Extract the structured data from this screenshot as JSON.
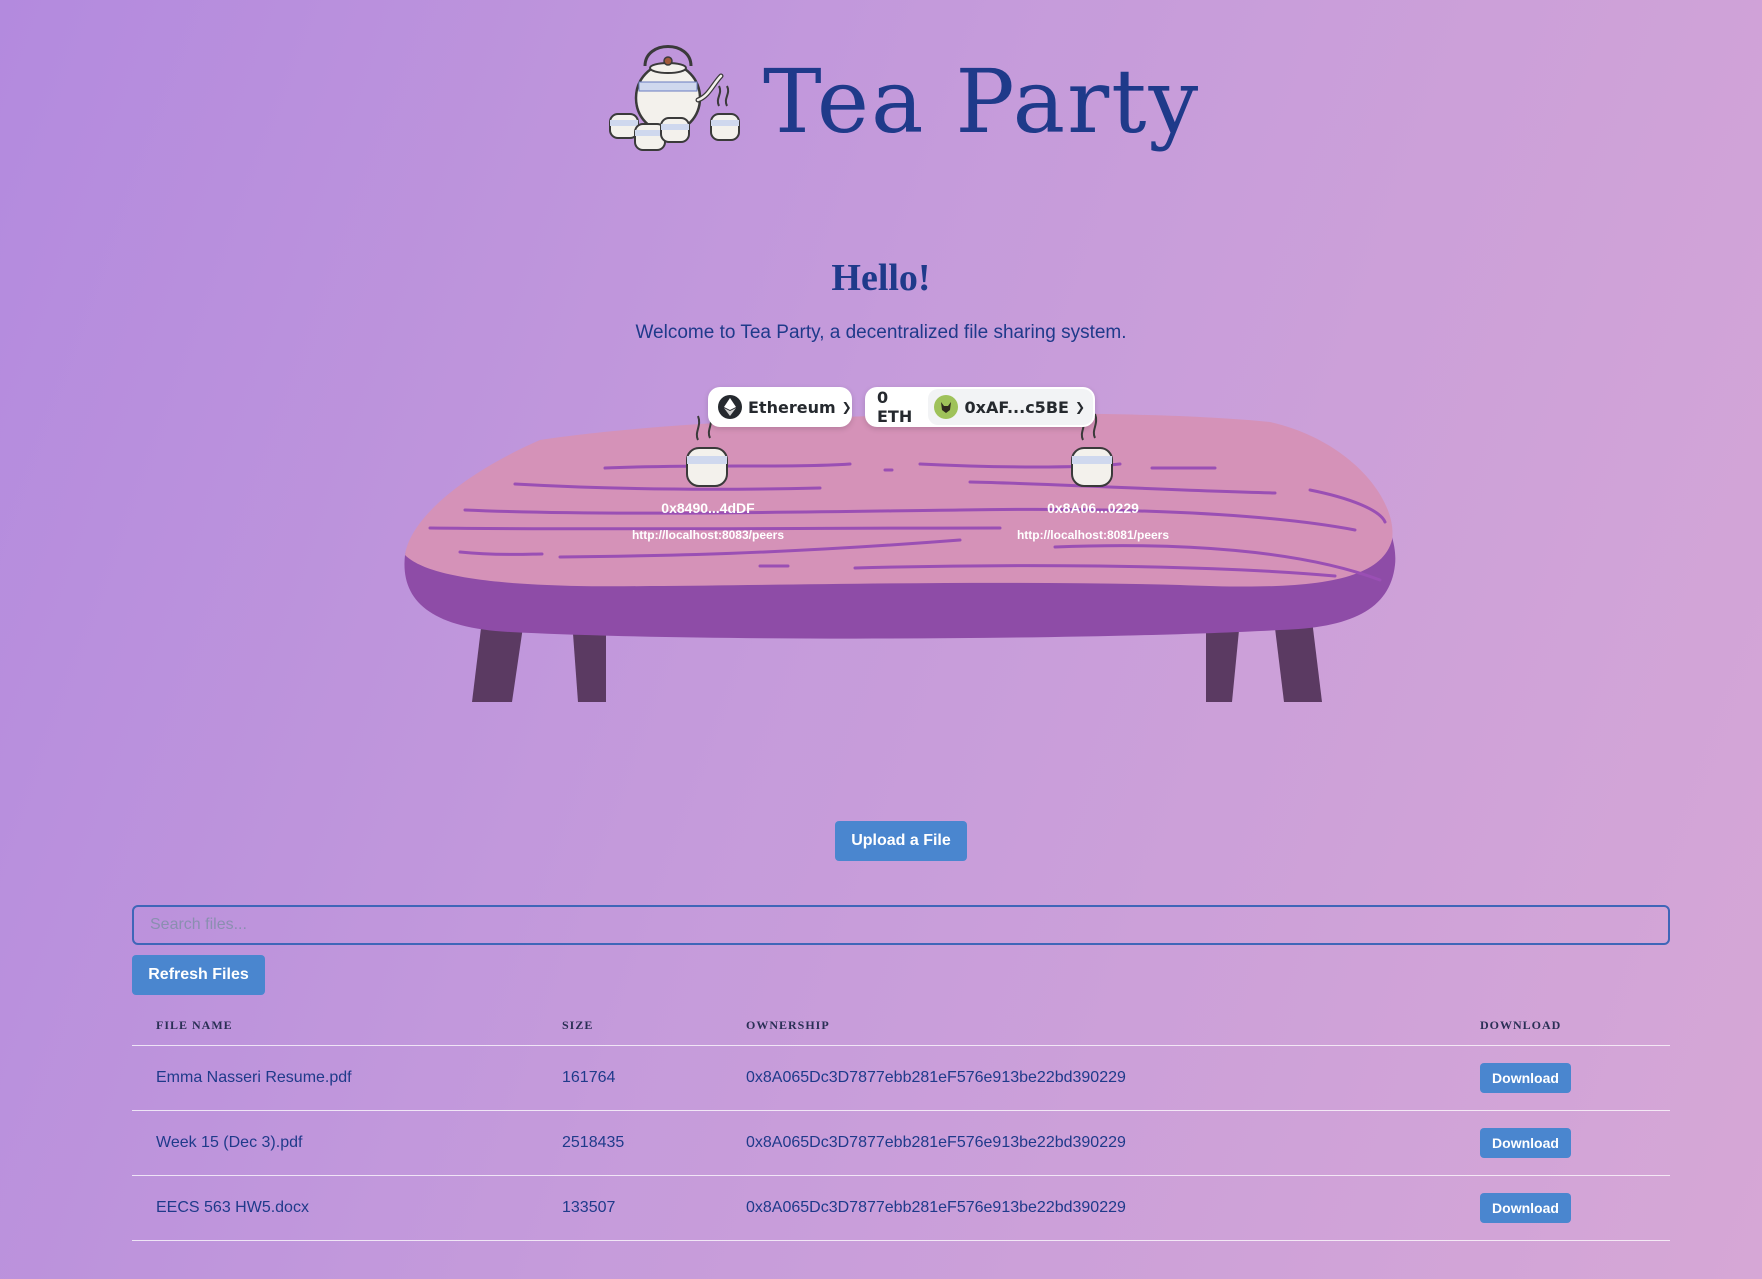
{
  "header": {
    "title": "Tea Party"
  },
  "intro": {
    "heading": "Hello!",
    "welcome": "Welcome to Tea Party, a decentralized file sharing system."
  },
  "wallet": {
    "network_label": "Ethereum",
    "balance": "0 ETH",
    "account": "0xAF...c5BE"
  },
  "peers": [
    {
      "address": "0x8490...4dDF",
      "url": "http://localhost:8083/peers"
    },
    {
      "address": "0x8A06...0229",
      "url": "http://localhost:8081/peers"
    }
  ],
  "actions": {
    "upload_label": "Upload a File",
    "refresh_label": "Refresh Files"
  },
  "search": {
    "placeholder": "Search files...",
    "value": ""
  },
  "table": {
    "headers": [
      "FILE NAME",
      "SIZE",
      "OWNERSHIP",
      "DOWNLOAD"
    ],
    "download_label": "Download",
    "rows": [
      {
        "name": "Emma Nasseri Resume.pdf",
        "size": "161764",
        "owner": "0x8A065Dc3D7877ebb281eF576e913be22bd390229"
      },
      {
        "name": "Week 15 (Dec 3).pdf",
        "size": "2518435",
        "owner": "0x8A065Dc3D7877ebb281eF576e913be22bd390229"
      },
      {
        "name": "EECS 563 HW5.docx",
        "size": "133507",
        "owner": "0x8A065Dc3D7877ebb281eF576e913be22bd390229"
      }
    ]
  },
  "colors": {
    "title_blue": "#1f3a8a",
    "button_blue": "#4a86cf",
    "table_top": "#d592b8",
    "table_edge": "#8e4ca7",
    "table_legs": "#5b3a62",
    "wood_grain": "#9a4fb4"
  }
}
